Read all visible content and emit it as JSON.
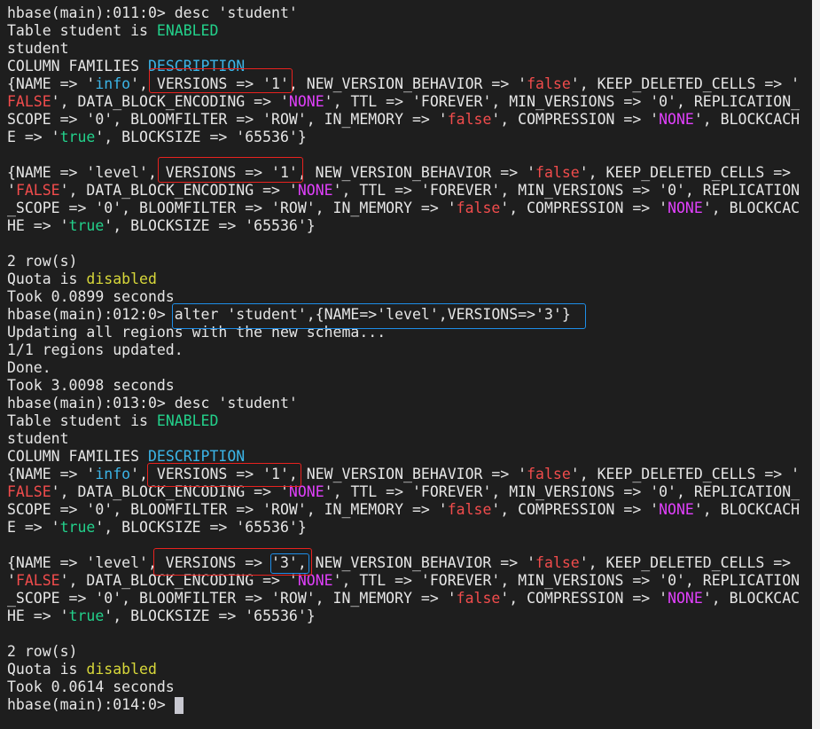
{
  "palette": {
    "w": "#e6e6e6",
    "g": "#23d18b",
    "c": "#3bb5e8",
    "r": "#f14c4c",
    "m": "#e040fb",
    "y": "#d7d73a"
  },
  "terminal": {
    "lines": [
      [
        [
          "hbase(main):011:0> desc 'student'",
          "w"
        ]
      ],
      [
        [
          "Table student is ",
          "w"
        ],
        [
          "ENABLED",
          "g"
        ]
      ],
      [
        [
          "student",
          "w"
        ]
      ],
      [
        [
          "COLUMN FAMILIES ",
          "w"
        ],
        [
          "DESCRIPTION",
          "c"
        ]
      ],
      [
        [
          "{NAME => '",
          "w"
        ],
        [
          "info",
          "c"
        ],
        [
          "', VERSIONS => '1', NEW_VERSION_BEHAVIOR => '",
          "w"
        ],
        [
          "false",
          "r"
        ],
        [
          "', KEEP_DELETED_CELLS => '",
          "w"
        ]
      ],
      [
        [
          "FALSE",
          "r"
        ],
        [
          "', DATA_BLOCK_ENCODING => '",
          "w"
        ],
        [
          "NONE",
          "m"
        ],
        [
          "', TTL => 'FOREVER', MIN_VERSIONS => '0', REPLICATION_",
          "w"
        ]
      ],
      [
        [
          "SCOPE => '0', BLOOMFILTER => 'ROW', IN_MEMORY => '",
          "w"
        ],
        [
          "false",
          "r"
        ],
        [
          "', COMPRESSION => '",
          "w"
        ],
        [
          "NONE",
          "m"
        ],
        [
          "', BLOCKCACH",
          "w"
        ]
      ],
      [
        [
          "E => '",
          "w"
        ],
        [
          "true",
          "g"
        ],
        [
          "', BLOCKSIZE => '65536'}",
          "w"
        ]
      ],
      [],
      [
        [
          "{NAME => 'level', VERSIONS => '1', NEW_VERSION_BEHAVIOR => '",
          "w"
        ],
        [
          "false",
          "r"
        ],
        [
          "', KEEP_DELETED_CELLS =>",
          "w"
        ]
      ],
      [
        [
          "'",
          "w"
        ],
        [
          "FALSE",
          "r"
        ],
        [
          "', DATA_BLOCK_ENCODING => '",
          "w"
        ],
        [
          "NONE",
          "m"
        ],
        [
          "', TTL => 'FOREVER', MIN_VERSIONS => '0', REPLICATION",
          "w"
        ]
      ],
      [
        [
          "_SCOPE => '0', BLOOMFILTER => 'ROW', IN_MEMORY => '",
          "w"
        ],
        [
          "false",
          "r"
        ],
        [
          "', COMPRESSION => '",
          "w"
        ],
        [
          "NONE",
          "m"
        ],
        [
          "', BLOCKCAC",
          "w"
        ]
      ],
      [
        [
          "HE => '",
          "w"
        ],
        [
          "true",
          "g"
        ],
        [
          "', BLOCKSIZE => '65536'}",
          "w"
        ]
      ],
      [],
      [
        [
          "2 row(s)",
          "w"
        ]
      ],
      [
        [
          "Quota is ",
          "w"
        ],
        [
          "disabled",
          "y"
        ]
      ],
      [
        [
          "Took 0.0899 seconds",
          "w"
        ]
      ],
      [
        [
          "hbase(main):012:0> alter 'student',{NAME=>'level',VERSIONS=>'3'}",
          "w"
        ]
      ],
      [
        [
          "Updating all regions with the new schema...",
          "w"
        ]
      ],
      [
        [
          "1/1 regions updated.",
          "w"
        ]
      ],
      [
        [
          "Done.",
          "w"
        ]
      ],
      [
        [
          "Took 3.0098 seconds",
          "w"
        ]
      ],
      [
        [
          "hbase(main):013:0> desc 'student'",
          "w"
        ]
      ],
      [
        [
          "Table student is ",
          "w"
        ],
        [
          "ENABLED",
          "g"
        ]
      ],
      [
        [
          "student",
          "w"
        ]
      ],
      [
        [
          "COLUMN FAMILIES ",
          "w"
        ],
        [
          "DESCRIPTION",
          "c"
        ]
      ],
      [
        [
          "{NAME => '",
          "w"
        ],
        [
          "info",
          "c"
        ],
        [
          "', VERSIONS => '1', NEW_VERSION_BEHAVIOR => '",
          "w"
        ],
        [
          "false",
          "r"
        ],
        [
          "', KEEP_DELETED_CELLS => '",
          "w"
        ]
      ],
      [
        [
          "FALSE",
          "r"
        ],
        [
          "', DATA_BLOCK_ENCODING => '",
          "w"
        ],
        [
          "NONE",
          "m"
        ],
        [
          "', TTL => 'FOREVER', MIN_VERSIONS => '0', REPLICATION_",
          "w"
        ]
      ],
      [
        [
          "SCOPE => '0', BLOOMFILTER => 'ROW', IN_MEMORY => '",
          "w"
        ],
        [
          "false",
          "r"
        ],
        [
          "', COMPRESSION => '",
          "w"
        ],
        [
          "NONE",
          "m"
        ],
        [
          "', BLOCKCACH",
          "w"
        ]
      ],
      [
        [
          "E => '",
          "w"
        ],
        [
          "true",
          "g"
        ],
        [
          "', BLOCKSIZE => '65536'}",
          "w"
        ]
      ],
      [],
      [
        [
          "{NAME => 'level', VERSIONS => '3', NEW_VERSION_BEHAVIOR => '",
          "w"
        ],
        [
          "false",
          "r"
        ],
        [
          "', KEEP_DELETED_CELLS =>",
          "w"
        ]
      ],
      [
        [
          "'",
          "w"
        ],
        [
          "FALSE",
          "r"
        ],
        [
          "', DATA_BLOCK_ENCODING => '",
          "w"
        ],
        [
          "NONE",
          "m"
        ],
        [
          "', TTL => 'FOREVER', MIN_VERSIONS => '0', REPLICATION",
          "w"
        ]
      ],
      [
        [
          "_SCOPE => '0', BLOOMFILTER => 'ROW', IN_MEMORY => '",
          "w"
        ],
        [
          "false",
          "r"
        ],
        [
          "', COMPRESSION => '",
          "w"
        ],
        [
          "NONE",
          "m"
        ],
        [
          "', BLOCKCAC",
          "w"
        ]
      ],
      [
        [
          "HE => '",
          "w"
        ],
        [
          "true",
          "g"
        ],
        [
          "', BLOCKSIZE => '65536'}",
          "w"
        ]
      ],
      [],
      [
        [
          "2 row(s)",
          "w"
        ]
      ],
      [
        [
          "Quota is ",
          "w"
        ],
        [
          "disabled",
          "y"
        ]
      ],
      [
        [
          "Took 0.0614 seconds",
          "w"
        ]
      ],
      [
        [
          "hbase(main):014:0> ",
          "w"
        ]
      ]
    ]
  }
}
